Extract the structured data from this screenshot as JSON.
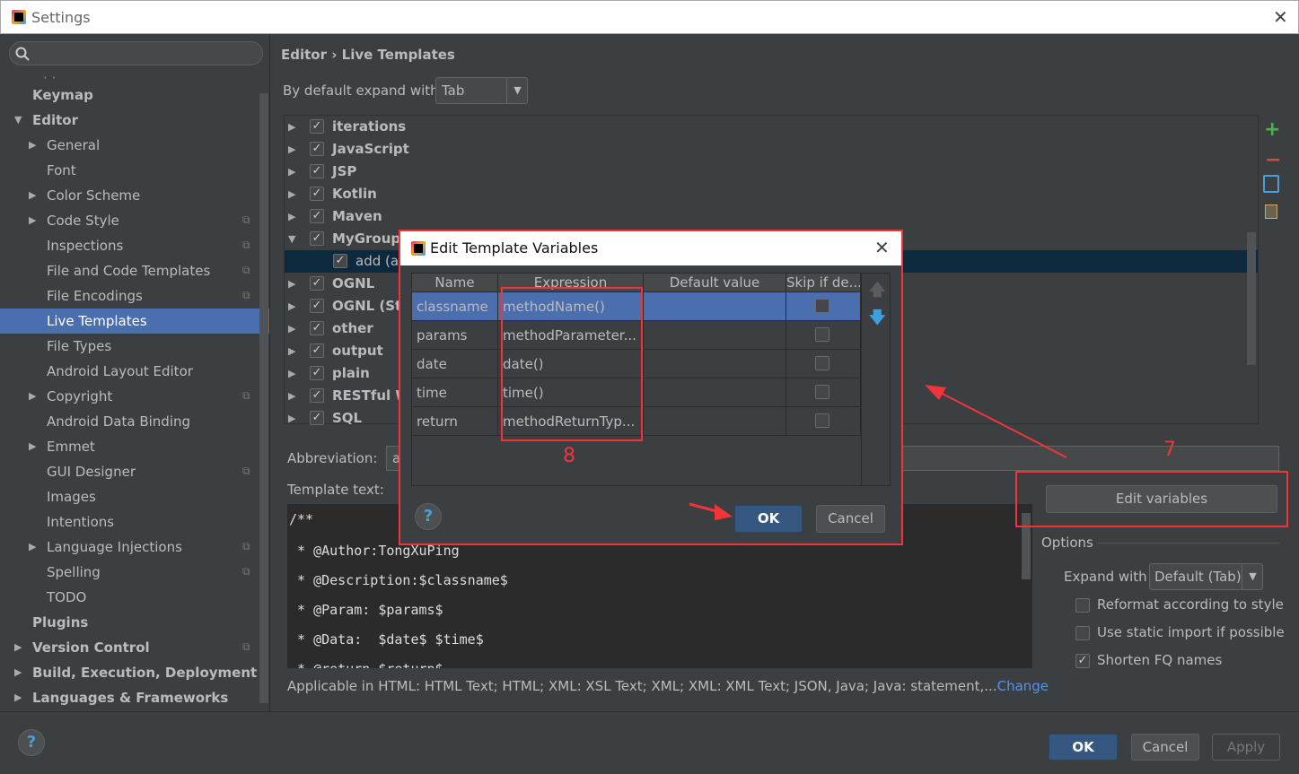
{
  "window": {
    "title": "Settings"
  },
  "sidebar": {
    "items": [
      {
        "label": "Keymap",
        "level": 0,
        "bold": true
      },
      {
        "label": "Editor",
        "level": 0,
        "bold": true,
        "expanded": true
      },
      {
        "label": "General",
        "level": 1,
        "arrow": true
      },
      {
        "label": "Font",
        "level": 1
      },
      {
        "label": "Color Scheme",
        "level": 1,
        "arrow": true
      },
      {
        "label": "Code Style",
        "level": 1,
        "arrow": true,
        "cfg": true
      },
      {
        "label": "Inspections",
        "level": 1,
        "cfg": true
      },
      {
        "label": "File and Code Templates",
        "level": 1,
        "cfg": true
      },
      {
        "label": "File Encodings",
        "level": 1,
        "cfg": true
      },
      {
        "label": "Live Templates",
        "level": 1,
        "selected": true
      },
      {
        "label": "File Types",
        "level": 1
      },
      {
        "label": "Android Layout Editor",
        "level": 1
      },
      {
        "label": "Copyright",
        "level": 1,
        "arrow": true,
        "cfg": true
      },
      {
        "label": "Android Data Binding",
        "level": 1
      },
      {
        "label": "Emmet",
        "level": 1,
        "arrow": true
      },
      {
        "label": "GUI Designer",
        "level": 1,
        "cfg": true
      },
      {
        "label": "Images",
        "level": 1
      },
      {
        "label": "Intentions",
        "level": 1
      },
      {
        "label": "Language Injections",
        "level": 1,
        "arrow": true,
        "cfg": true
      },
      {
        "label": "Spelling",
        "level": 1,
        "cfg": true
      },
      {
        "label": "TODO",
        "level": 1
      },
      {
        "label": "Plugins",
        "level": 0,
        "bold": true
      },
      {
        "label": "Version Control",
        "level": 0,
        "bold": true,
        "arrow": true,
        "cfg": true
      },
      {
        "label": "Build, Execution, Deployment",
        "level": 0,
        "bold": true,
        "arrow": true
      },
      {
        "label": "Languages & Frameworks",
        "level": 0,
        "bold": true,
        "arrow": true
      }
    ]
  },
  "main": {
    "breadcrumb": {
      "parent": "Editor",
      "sep": "›",
      "current": "Live Templates"
    },
    "expand_label": "By default expand with",
    "expand_value": "Tab",
    "tree": [
      {
        "label": "iterations"
      },
      {
        "label": "JavaScript"
      },
      {
        "label": "JSP"
      },
      {
        "label": "Kotlin"
      },
      {
        "label": "Maven"
      },
      {
        "label": "MyGroup",
        "expanded": true
      },
      {
        "label": "add (ad",
        "child": true,
        "selected": true
      },
      {
        "label": "OGNL"
      },
      {
        "label": "OGNL (Str"
      },
      {
        "label": "other"
      },
      {
        "label": "output"
      },
      {
        "label": "plain"
      },
      {
        "label": "RESTful W"
      },
      {
        "label": "SQL"
      }
    ],
    "abbreviation_label": "Abbreviation:",
    "abbreviation_value": "a",
    "template_text_label": "Template text:",
    "template_lines": [
      "/**",
      " * @Author:TongXuPing",
      " * @Description:$classname$",
      " * @Param: $params$",
      " * @Data:  $date$ $time$",
      " * @return $return$"
    ],
    "edit_variables": "Edit variables",
    "options_label": "Options",
    "expand_with_label": "Expand with",
    "expand_with_value": "Default (Tab)",
    "options": [
      {
        "label": "Reformat according to style",
        "checked": false
      },
      {
        "label": "Use static import if possible",
        "checked": false
      },
      {
        "label": "Shorten FQ names",
        "checked": true
      }
    ],
    "applicable": "Applicable in HTML: HTML Text; HTML; XML: XSL Text; XML; XML: XML Text; JSON, Java; Java: statement,...",
    "change_link": "Change"
  },
  "footer": {
    "ok": "OK",
    "cancel": "Cancel",
    "apply": "Apply",
    "help": "?"
  },
  "dialog": {
    "title": "Edit Template Variables",
    "columns": [
      "Name",
      "Expression",
      "Default value",
      "Skip if de..."
    ],
    "rows": [
      {
        "name": "classname",
        "expression": "methodName()",
        "default": "",
        "skip": false
      },
      {
        "name": "params",
        "expression": "methodParameter...",
        "default": "",
        "skip": false
      },
      {
        "name": "date",
        "expression": "date()",
        "default": "",
        "skip": false
      },
      {
        "name": "time",
        "expression": "time()",
        "default": "",
        "skip": false
      },
      {
        "name": "return",
        "expression": "methodReturnTyp...",
        "default": "",
        "skip": false
      }
    ],
    "ok": "OK",
    "cancel": "Cancel",
    "help": "?"
  },
  "annotations": {
    "step7": "7",
    "step8": "8",
    "color": "#f0353a"
  }
}
